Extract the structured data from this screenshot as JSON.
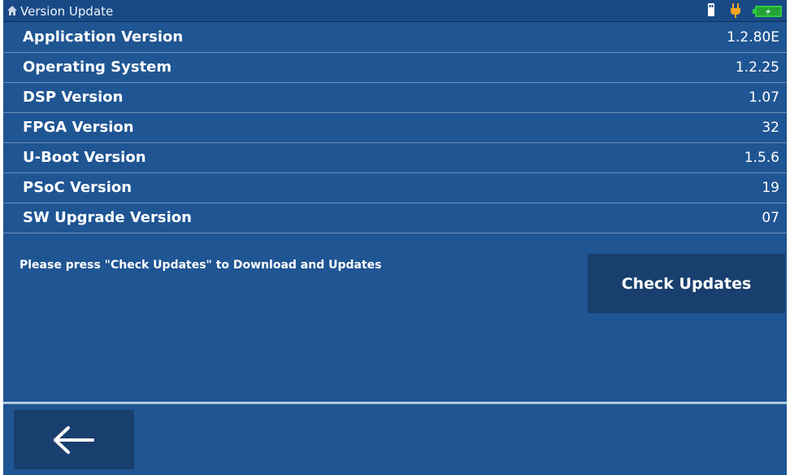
{
  "titlebar": {
    "title": "Version Update",
    "icons": [
      "home-icon",
      "usb-drive-icon",
      "power-plug-icon",
      "battery-charging-icon"
    ],
    "plug_color": "#f5a623",
    "battery_color": "#2ecc40"
  },
  "versions": [
    {
      "label": "Application Version",
      "value": "1.2.80E"
    },
    {
      "label": "Operating System",
      "value": "1.2.25"
    },
    {
      "label": "DSP Version",
      "value": "1.07"
    },
    {
      "label": "FPGA Version",
      "value": "32"
    },
    {
      "label": "U-Boot Version",
      "value": "1.5.6"
    },
    {
      "label": "PSoC Version",
      "value": "19"
    },
    {
      "label": "SW Upgrade Version",
      "value": "07"
    }
  ],
  "update": {
    "prompt": "Please press \"Check Updates\" to Download and Updates",
    "check_button_label": "Check Updates"
  },
  "footer": {
    "back_icon": "left-arrow-icon"
  },
  "colors": {
    "background": "#1f5593",
    "button": "#193f6e"
  }
}
